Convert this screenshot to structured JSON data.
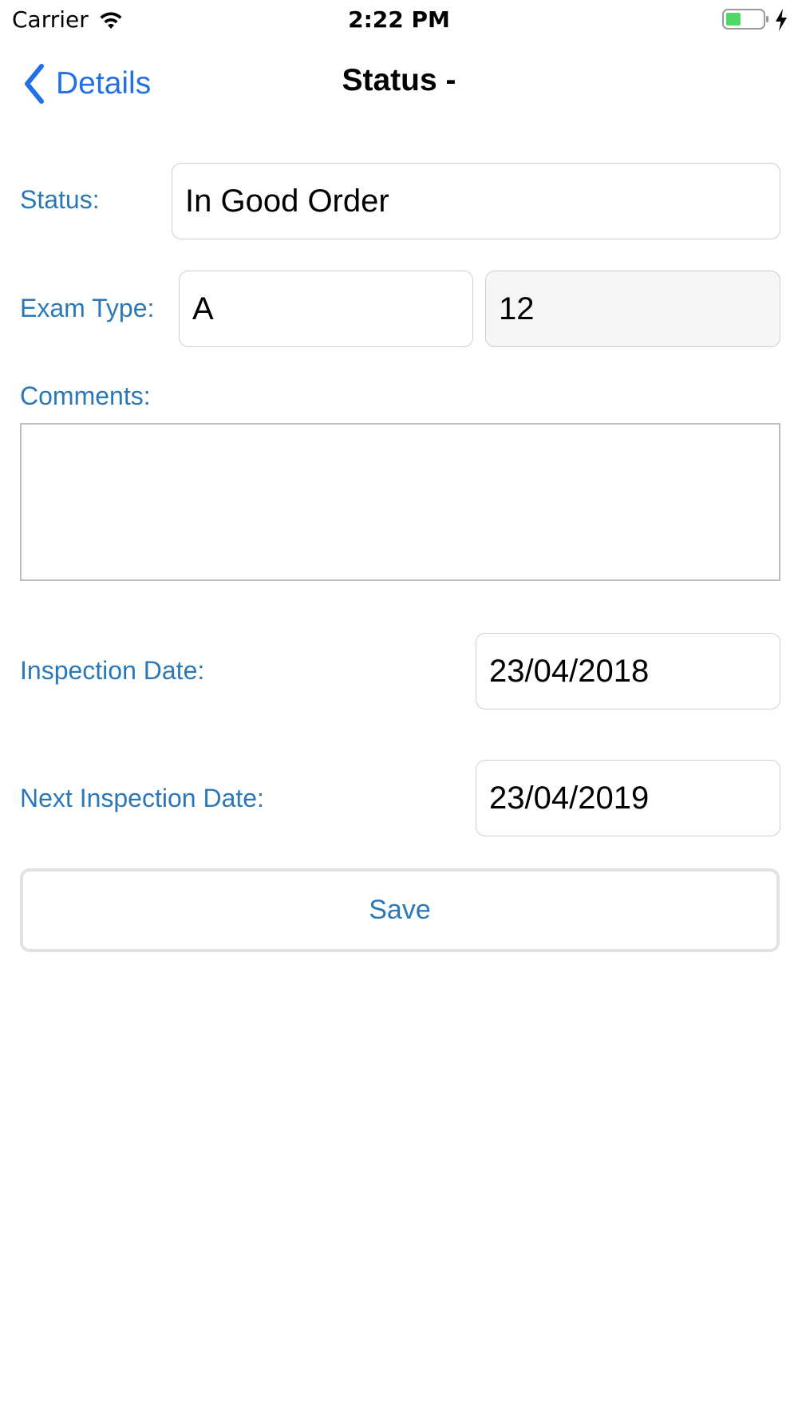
{
  "status_bar": {
    "carrier": "Carrier",
    "time": "2:22 PM",
    "wifi_icon": "wifi-icon",
    "battery_icon": "battery-charging-icon",
    "battery_color": "#4cd964"
  },
  "nav": {
    "back_label": "Details",
    "back_icon": "chevron-left-icon",
    "title": "Status -",
    "accent_color": "#2370e6"
  },
  "form": {
    "status_label": "Status:",
    "status_value": "In Good Order",
    "exam_type_label": "Exam Type:",
    "exam_type_value": "A",
    "exam_type_number": "12",
    "comments_label": "Comments:",
    "comments_value": "",
    "inspection_date_label": "Inspection Date:",
    "inspection_date_value": "23/04/2018",
    "next_inspection_date_label": "Next Inspection Date:",
    "next_inspection_date_value": "23/04/2019",
    "label_color": "#2b78b8"
  },
  "actions": {
    "save_label": "Save"
  }
}
